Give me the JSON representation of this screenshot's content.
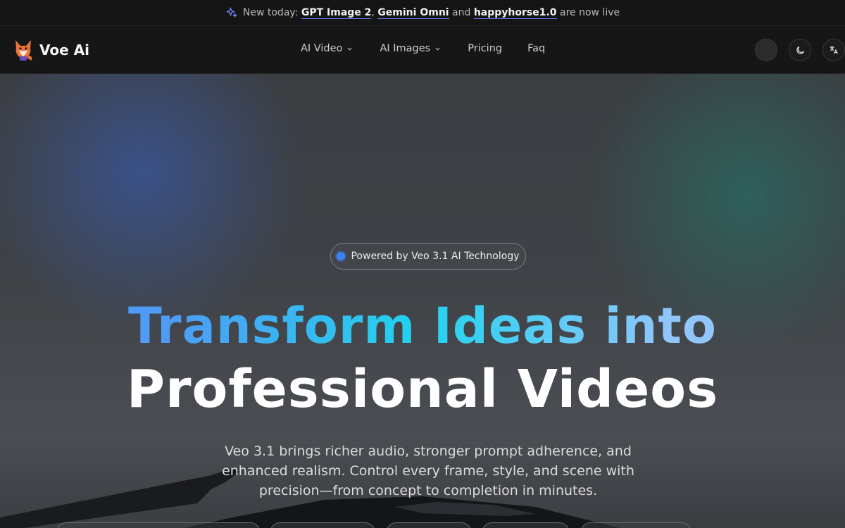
{
  "announcement": {
    "prefix": "New today: ",
    "item1": "GPT Image 2",
    "sep1": ", ",
    "item2": "Gemini Omni",
    "sep2": " and ",
    "item3": "happyhorse1.0",
    "suffix": " are now live",
    "icon": "sparkle-icon"
  },
  "brand": {
    "name": "Voe Ai",
    "logo": "fox-logo"
  },
  "nav": {
    "items": [
      {
        "label": "AI Video",
        "has_dropdown": true
      },
      {
        "label": "AI Images",
        "has_dropdown": true
      },
      {
        "label": "Pricing",
        "has_dropdown": false
      },
      {
        "label": "Faq",
        "has_dropdown": false
      }
    ],
    "actions": [
      "avatar",
      "moon-icon",
      "translate-icon"
    ]
  },
  "hero": {
    "badge": "Powered by Veo 3.1 AI Technology",
    "headline_line1": "Transform Ideas into",
    "headline_line2": "Professional Videos",
    "subtitle": "Veo 3.1 brings richer audio, stronger prompt adherence, and enhanced realism. Control every frame, style, and scene with precision—from concept to completion in minutes."
  },
  "colors": {
    "accent_blue": "#3b82f6",
    "gradient_start": "#4f9bf5",
    "gradient_mid": "#22d3ee",
    "gradient_end": "#93c5fd"
  }
}
